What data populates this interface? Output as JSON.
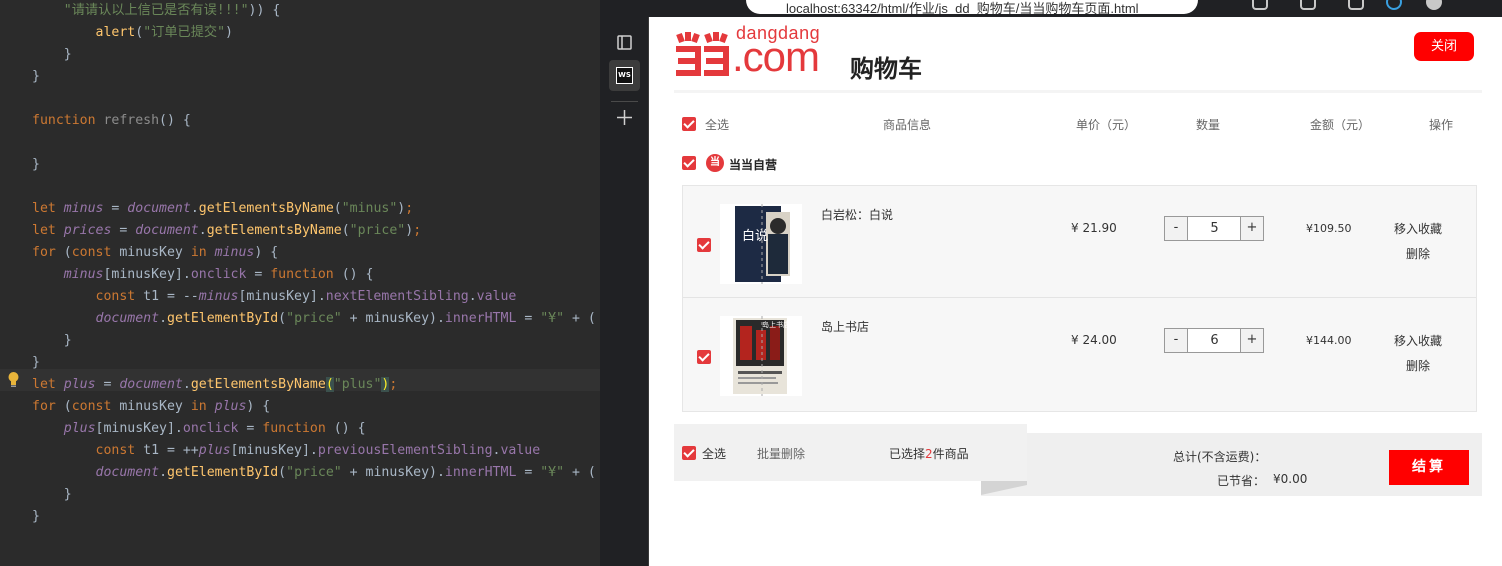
{
  "editor": {
    "lines": [
      [
        [
          "str",
          "    \"请请认以上信已是否有误!!!\""
        ],
        [
          "m",
          ")) {"
        ]
      ],
      [
        [
          "m",
          "        "
        ],
        [
          "fn",
          "alert"
        ],
        [
          "m",
          "("
        ],
        [
          "str",
          "\"订单已提交\""
        ],
        [
          "m",
          ")"
        ]
      ],
      [
        [
          "m",
          "    }"
        ]
      ],
      [
        [
          "m",
          "}"
        ]
      ],
      [],
      [
        [
          "kw",
          "function "
        ],
        [
          "unused",
          "refresh"
        ],
        [
          "m",
          "() {"
        ]
      ],
      [],
      [
        [
          "m",
          "}"
        ]
      ],
      [],
      [
        [
          "kw",
          "let "
        ],
        [
          "var",
          "minus"
        ],
        [
          "m",
          " = "
        ],
        [
          "var",
          "document"
        ],
        [
          "m",
          "."
        ],
        [
          "fn",
          "getElementsByName"
        ],
        [
          "m",
          "("
        ],
        [
          "str",
          "\"minus\""
        ],
        [
          "m",
          ")"
        ],
        [
          "kw",
          ";"
        ]
      ],
      [
        [
          "kw",
          "let "
        ],
        [
          "var",
          "prices"
        ],
        [
          "m",
          " = "
        ],
        [
          "var",
          "document"
        ],
        [
          "m",
          "."
        ],
        [
          "fn",
          "getElementsByName"
        ],
        [
          "m",
          "("
        ],
        [
          "str",
          "\"price\""
        ],
        [
          "m",
          ")"
        ],
        [
          "kw",
          ";"
        ]
      ],
      [
        [
          "kw",
          "for "
        ],
        [
          "m",
          "("
        ],
        [
          "kw",
          "const "
        ],
        [
          "m",
          "minusKey "
        ],
        [
          "kw",
          "in "
        ],
        [
          "var",
          "minus"
        ],
        [
          "m",
          ") {"
        ]
      ],
      [
        [
          "m",
          "    "
        ],
        [
          "var",
          "minus"
        ],
        [
          "m",
          "[minusKey]."
        ],
        [
          "prop",
          "onclick"
        ],
        [
          "m",
          " = "
        ],
        [
          "kw",
          "function "
        ],
        [
          "m",
          "() {"
        ]
      ],
      [
        [
          "m",
          "        "
        ],
        [
          "kw",
          "const "
        ],
        [
          "m",
          "t1 = --"
        ],
        [
          "var",
          "minus"
        ],
        [
          "m",
          "[minusKey]."
        ],
        [
          "prop",
          "nextElementSibling"
        ],
        [
          "m",
          "."
        ],
        [
          "prop",
          "value"
        ]
      ],
      [
        [
          "m",
          "        "
        ],
        [
          "var",
          "document"
        ],
        [
          "m",
          "."
        ],
        [
          "fn",
          "getElementById"
        ],
        [
          "m",
          "("
        ],
        [
          "str",
          "\"price\""
        ],
        [
          "m",
          " + minusKey)."
        ],
        [
          "prop",
          "innerHTML"
        ],
        [
          "m",
          " = "
        ],
        [
          "str",
          "\"¥\""
        ],
        [
          "m",
          " + ("
        ]
      ],
      [
        [
          "m",
          "    }"
        ]
      ],
      [
        [
          "m",
          "}"
        ]
      ],
      [
        [
          "kw",
          "let "
        ],
        [
          "var",
          "plus"
        ],
        [
          "m",
          " = "
        ],
        [
          "var",
          "document"
        ],
        [
          "m",
          "."
        ],
        [
          "fn",
          "getElementsByName"
        ],
        [
          "brk",
          "("
        ],
        [
          "str",
          "\"plus\""
        ],
        [
          "brk",
          ")"
        ],
        [
          "kw",
          ";"
        ]
      ],
      [
        [
          "kw",
          "for "
        ],
        [
          "m",
          "("
        ],
        [
          "kw",
          "const "
        ],
        [
          "m",
          "minusKey "
        ],
        [
          "kw",
          "in "
        ],
        [
          "var",
          "plus"
        ],
        [
          "m",
          ") {"
        ]
      ],
      [
        [
          "m",
          "    "
        ],
        [
          "var",
          "plus"
        ],
        [
          "m",
          "[minusKey]."
        ],
        [
          "prop",
          "onclick"
        ],
        [
          "m",
          " = "
        ],
        [
          "kw",
          "function "
        ],
        [
          "m",
          "() {"
        ]
      ],
      [
        [
          "m",
          "        "
        ],
        [
          "kw",
          "const "
        ],
        [
          "m",
          "t1 = ++"
        ],
        [
          "var",
          "plus"
        ],
        [
          "m",
          "[minusKey]."
        ],
        [
          "prop",
          "previousElementSibling"
        ],
        [
          "m",
          "."
        ],
        [
          "prop",
          "value"
        ]
      ],
      [
        [
          "m",
          "        "
        ],
        [
          "var",
          "document"
        ],
        [
          "m",
          "."
        ],
        [
          "fn",
          "getElementById"
        ],
        [
          "m",
          "("
        ],
        [
          "str",
          "\"price\""
        ],
        [
          "m",
          " + minusKey)."
        ],
        [
          "prop",
          "innerHTML"
        ],
        [
          "m",
          " = "
        ],
        [
          "str",
          "\"¥\""
        ],
        [
          "m",
          " + ("
        ]
      ],
      [
        [
          "m",
          "    }"
        ]
      ],
      [
        [
          "m",
          "}"
        ]
      ]
    ]
  },
  "browser": {
    "address": "localhost:63342/html/作业/js_dd_购物车/当当购物车页面.html"
  },
  "sidebar": {
    "ws_label": "WS"
  },
  "page": {
    "logo": {
      "domain": "dangdang",
      "com": ".com",
      "cart_text": "购物车"
    },
    "close_label": "关闭",
    "headers": {
      "select_all": "全选",
      "product_info": "商品信息",
      "unit_price": "单价（元）",
      "quantity": "数量",
      "amount": "金额（元）",
      "actions": "操作"
    },
    "shop": {
      "icon": "当",
      "name": "当当自营"
    },
    "items": [
      {
        "title": "白岩松：白说",
        "price": "¥ 21.90",
        "qty": "5",
        "minus": "-",
        "plus": "+",
        "amount": "¥109.50",
        "fav": "移入收藏",
        "del": "删除",
        "cover_text": "白说"
      },
      {
        "title": "岛上书店",
        "price": "¥ 24.00",
        "qty": "6",
        "minus": "-",
        "plus": "+",
        "amount": "¥144.00",
        "fav": "移入收藏",
        "del": "删除",
        "cover_text": "岛上书店"
      }
    ],
    "footer": {
      "select_all": "全选",
      "batch_delete": "批量删除",
      "selected_prefix": "已选择",
      "selected_count": "2",
      "selected_suffix": "件商品",
      "total_label": "总计(不含运费)：",
      "saved_label": "已节省：",
      "saved_value": "¥0.00",
      "settle_label": "结算"
    }
  },
  "colors": {
    "brand_red": "#e4393c",
    "button_red": "#ff0000",
    "editor_bg": "#2b2b2b",
    "keyword": "#cc7832",
    "string": "#6a8759",
    "variable": "#9876aa",
    "function": "#ffc66d"
  }
}
